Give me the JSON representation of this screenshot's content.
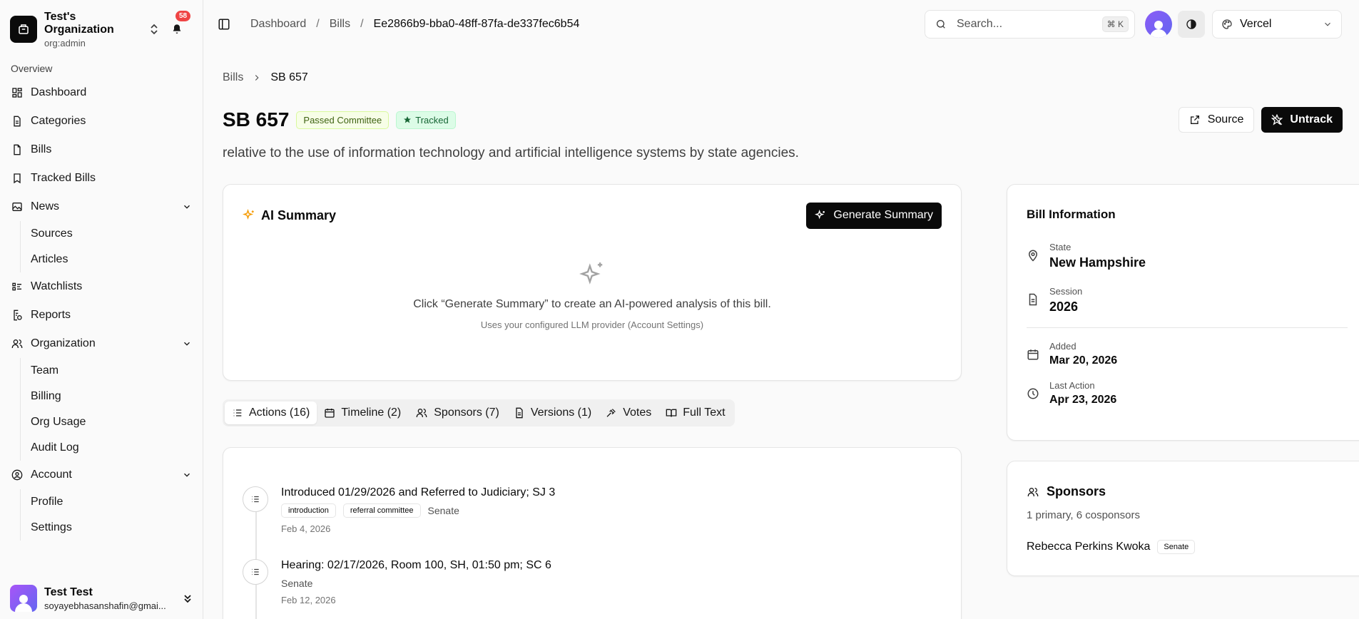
{
  "org": {
    "name": "Test's Organization",
    "role": "org:admin",
    "notifications": "58"
  },
  "sidebar": {
    "section_label": "Overview",
    "items": [
      {
        "label": "Dashboard"
      },
      {
        "label": "Categories"
      },
      {
        "label": "Bills"
      },
      {
        "label": "Tracked Bills"
      },
      {
        "label": "News",
        "children": [
          "Sources",
          "Articles"
        ]
      },
      {
        "label": "Watchlists"
      },
      {
        "label": "Reports"
      },
      {
        "label": "Organization",
        "children": [
          "Team",
          "Billing",
          "Org Usage",
          "Audit Log"
        ]
      },
      {
        "label": "Account",
        "children": [
          "Profile",
          "Settings"
        ]
      }
    ]
  },
  "user": {
    "name": "Test Test",
    "email": "soyayebhasanshafin@gmai..."
  },
  "topbar": {
    "breadcrumb": [
      "Dashboard",
      "Bills",
      "Ee2866b9-bba0-48ff-87fa-de337fec6b54"
    ],
    "search_placeholder": "Search...",
    "search_shortcut": "⌘ K",
    "theme": "Vercel"
  },
  "page": {
    "breadcrumb": [
      "Bills",
      "SB 657"
    ],
    "title": "SB 657",
    "status_badge": "Passed Committee",
    "tracked_badge": "Tracked",
    "source_button": "Source",
    "untrack_button": "Untrack",
    "description": "relative to the use of information technology and artificial intelligence systems by state agencies."
  },
  "ai_summary": {
    "title": "AI Summary",
    "generate_button": "Generate Summary",
    "empty_text": "Click “Generate Summary” to create an AI-powered analysis of this bill.",
    "empty_hint": "Uses your configured LLM provider (Account Settings)"
  },
  "tabs": [
    "Actions (16)",
    "Timeline (2)",
    "Sponsors (7)",
    "Versions (1)",
    "Votes",
    "Full Text"
  ],
  "actions": [
    {
      "title": "Introduced 01/29/2026 and Referred to Judiciary; SJ 3",
      "tags": [
        "introduction",
        "referral committee"
      ],
      "chamber": "Senate",
      "date": "Feb 4, 2026"
    },
    {
      "title": "Hearing: 02/17/2026, Room 100, SH, 01:50 pm; SC 6",
      "tags": [],
      "chamber": "Senate",
      "date": "Feb 12, 2026"
    }
  ],
  "bill_info": {
    "title": "Bill Information",
    "state_label": "State",
    "state": "New Hampshire",
    "session_label": "Session",
    "session": "2026",
    "added_label": "Added",
    "added": "Mar 20, 2026",
    "last_action_label": "Last Action",
    "last_action": "Apr 23, 2026"
  },
  "sponsors": {
    "title": "Sponsors",
    "summary": "1 primary, 6 cosponsors",
    "first_name": "Rebecca Perkins Kwoka",
    "first_chamber": "Senate"
  }
}
